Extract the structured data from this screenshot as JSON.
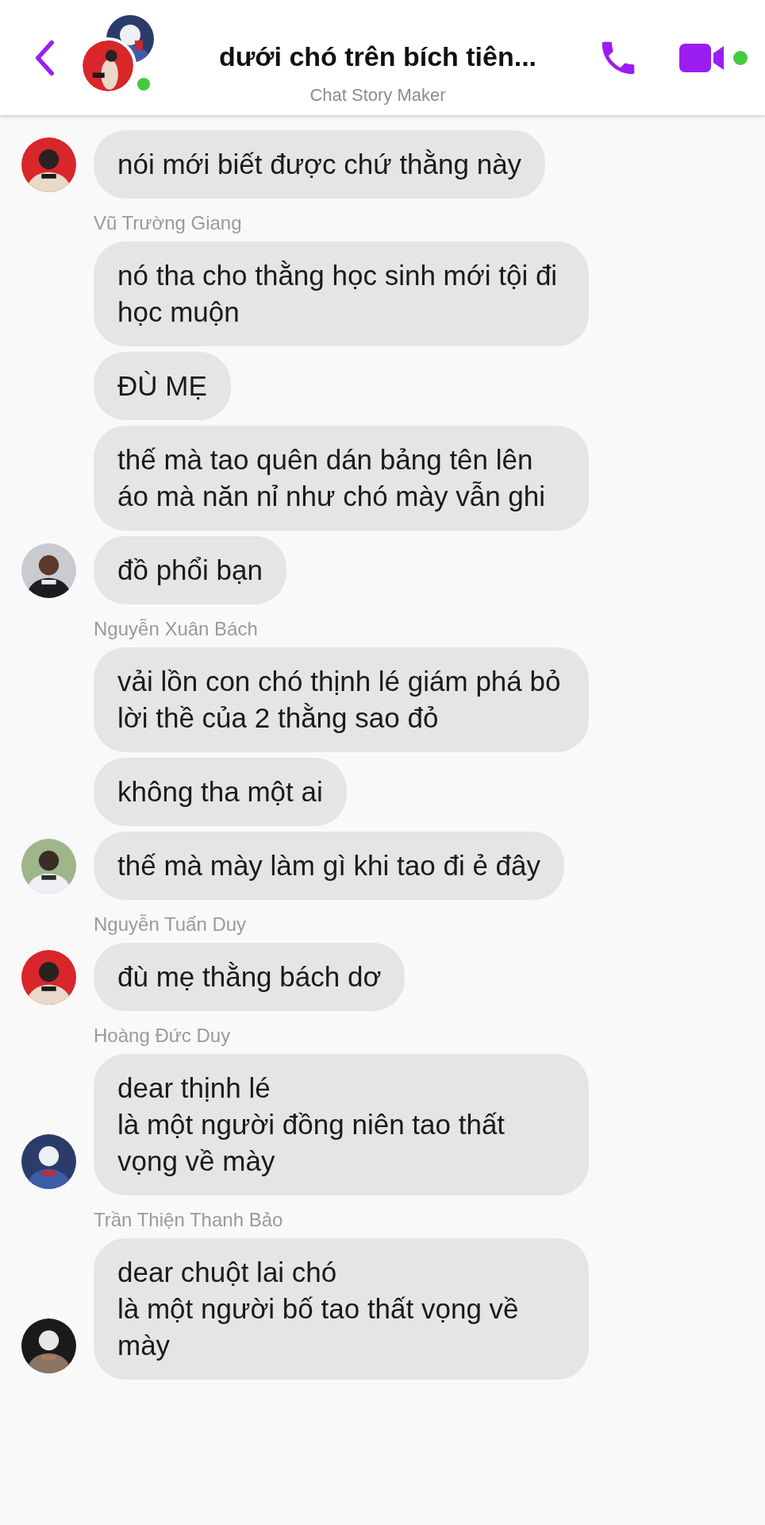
{
  "header": {
    "title": "dưới chó trên bích tiên...",
    "subtitle": "Chat Story Maker",
    "online": true,
    "video_active": true
  },
  "groups": [
    {
      "messages": [
        "nói mới biết được chứ thằng này"
      ]
    },
    {
      "sender": "Vũ Trường Giang",
      "messages": [
        "nó tha cho thằng học sinh mới tội đi học muộn",
        "ĐÙ MẸ",
        "thế mà tao quên dán bảng tên lên áo mà năn nỉ như chó mày vẫn ghi",
        "đồ phổi bạn"
      ]
    },
    {
      "sender": "Nguyễn Xuân Bách",
      "messages": [
        "vải lồn con chó thịnh lé giám phá bỏ lời thề của 2 thằng sao đỏ",
        "không tha một ai",
        "thế mà mày làm gì khi tao đi ẻ đây"
      ]
    },
    {
      "sender": "Nguyễn Tuấn Duy",
      "messages": [
        "đù mẹ thằng bách dơ"
      ]
    },
    {
      "sender": "Hoàng Đức Duy",
      "messages": [
        "dear thịnh lé\nlà một người đồng niên tao thất vọng về mày"
      ]
    },
    {
      "sender": "Trần Thiện Thanh Bảo",
      "messages": [
        "dear chuột lai chó\nlà một người bố tao thất vọng về mày"
      ]
    }
  ]
}
